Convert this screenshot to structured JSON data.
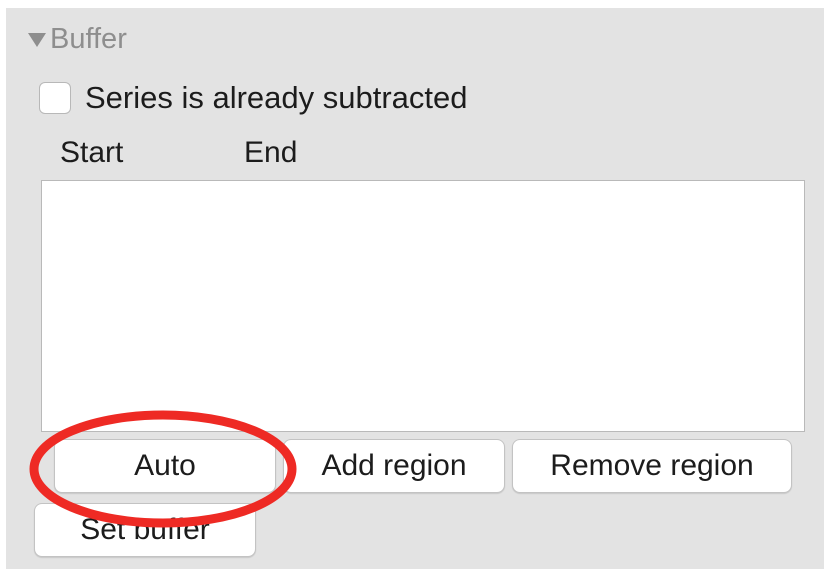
{
  "section": {
    "title": "Buffer",
    "icon": "disclosure-triangle-down-icon"
  },
  "checkbox": {
    "label": "Series is already subtracted",
    "checked": false
  },
  "table": {
    "columns": [
      "Start",
      "End"
    ],
    "rows": []
  },
  "buttons": {
    "auto": "Auto",
    "add_region": "Add region",
    "remove_region": "Remove region",
    "set_buffer": "Set buffer"
  },
  "annotation": {
    "color": "#ee2a24",
    "target": "Auto"
  }
}
